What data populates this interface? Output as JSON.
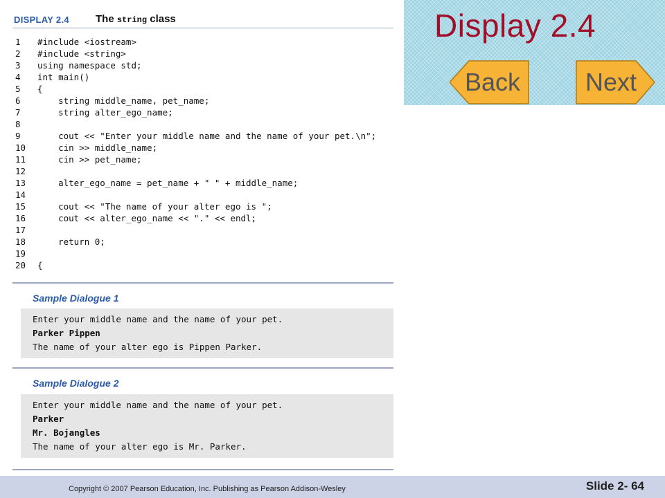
{
  "display": {
    "label": "DISPLAY 2.4",
    "title_prefix": "The ",
    "title_mono": "string",
    "title_suffix": " class"
  },
  "code": [
    {
      "n": "1",
      "text": "#include <iostream>"
    },
    {
      "n": "2",
      "text": "#include <string>"
    },
    {
      "n": "3",
      "text": "using namespace std;"
    },
    {
      "n": "4",
      "text": "int main()"
    },
    {
      "n": "5",
      "text": "{"
    },
    {
      "n": "6",
      "text": "    string middle_name, pet_name;"
    },
    {
      "n": "7",
      "text": "    string alter_ego_name;"
    },
    {
      "n": "8",
      "text": ""
    },
    {
      "n": "9",
      "text": "    cout << \"Enter your middle name and the name of your pet.\\n\";"
    },
    {
      "n": "10",
      "text": "    cin >> middle_name;"
    },
    {
      "n": "11",
      "text": "    cin >> pet_name;"
    },
    {
      "n": "12",
      "text": ""
    },
    {
      "n": "13",
      "text": "    alter_ego_name = pet_name + \" \" + middle_name;"
    },
    {
      "n": "14",
      "text": ""
    },
    {
      "n": "15",
      "text": "    cout << \"The name of your alter ego is \";"
    },
    {
      "n": "16",
      "text": "    cout << alter_ego_name << \".\" << endl;"
    },
    {
      "n": "17",
      "text": ""
    },
    {
      "n": "18",
      "text": "    return 0;"
    },
    {
      "n": "19",
      "text": ""
    },
    {
      "n": "20",
      "text": "{"
    }
  ],
  "dialogue1": {
    "title": "Sample Dialogue 1",
    "lines": [
      {
        "text": "Enter your middle name and the name of your pet.",
        "bold": false
      },
      {
        "text": "Parker Pippen",
        "bold": true
      },
      {
        "text": "The name of your alter ego is Pippen Parker.",
        "bold": false
      }
    ]
  },
  "dialogue2": {
    "title": "Sample Dialogue 2",
    "lines": [
      {
        "text": "Enter your middle name and the name of your pet.",
        "bold": false
      },
      {
        "text": "Parker",
        "bold": true
      },
      {
        "text": "Mr. Bojangles",
        "bold": true
      },
      {
        "text": "The name of your alter ego is Mr. Parker.",
        "bold": false
      }
    ]
  },
  "panel": {
    "title": "Display 2.4",
    "back_label": "Back",
    "next_label": "Next",
    "arrow_fill": "#f6b336",
    "title_color": "#a0102a"
  },
  "footer": {
    "copyright": "Copyright © 2007 Pearson Education, Inc. Publishing as Pearson Addison-Wesley",
    "slide_number": "Slide 2- 64"
  }
}
